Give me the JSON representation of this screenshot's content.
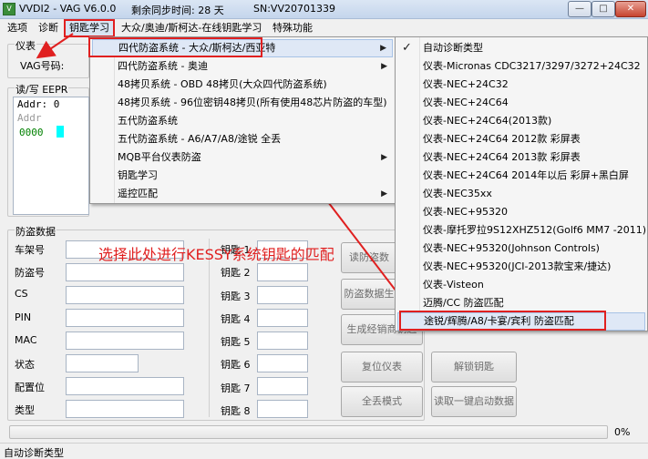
{
  "window": {
    "title": "VVDI2 - VAG V6.0.0",
    "sync_remaining": "剩余同步时间: 28 天",
    "serial": "SN:VV20701339",
    "minimize": "—",
    "maximize": "□",
    "close": "✕"
  },
  "menubar": [
    "选项",
    "诊断",
    "钥匙学习",
    "大众/奥迪/斯柯达-在线钥匙学习",
    "特殊功能"
  ],
  "main": {
    "instrument_group": "仪表",
    "vag_label": "VAG号码:",
    "rw_group": "读/写 EEPR",
    "hex_addr_header": "Addr: 0",
    "hex_col": "Addr",
    "hex_row": "0000"
  },
  "immo": {
    "group_title": "防盗数据",
    "left_labels": [
      "车架号",
      "防盗号",
      "CS",
      "PIN",
      "MAC",
      "状态",
      "配置位",
      "类型"
    ],
    "key_labels": [
      "钥匙 1",
      "钥匙 2",
      "钥匙 3",
      "钥匙 4",
      "钥匙 5",
      "钥匙 6",
      "钥匙 7",
      "钥匙 8"
    ],
    "buttons": [
      "读防盗数",
      "防盗数据生",
      "生成经销商钥匙",
      "复位仪表",
      "解锁钥匙",
      "全丢模式",
      "读取一键启动数据"
    ]
  },
  "menu1": {
    "items": [
      {
        "label": "四代防盗系统 - 大众/斯柯达/西亚特",
        "arrow": "▶"
      },
      {
        "label": "四代防盗系统 - 奥迪",
        "arrow": "▶"
      },
      {
        "label": "48拷贝系统 - OBD 48拷贝(大众四代防盗系统)",
        "arrow": ""
      },
      {
        "label": "48拷贝系统 - 96位密钥48拷贝(所有使用48芯片防盗的车型)",
        "arrow": ""
      },
      {
        "label": "五代防盗系统",
        "arrow": ""
      },
      {
        "label": "五代防盗系统 - A6/A7/A8/途锐 全丢",
        "arrow": ""
      },
      {
        "label": "MQB平台仪表防盗",
        "arrow": "▶"
      },
      {
        "label": "钥匙学习",
        "arrow": ""
      },
      {
        "label": "遥控匹配",
        "arrow": "▶"
      }
    ]
  },
  "menu2": {
    "check": "✓",
    "items": [
      "自动诊断类型",
      "仪表-Micronas CDC3217/3297/3272+24C32",
      "仪表-NEC+24C32",
      "仪表-NEC+24C64",
      "仪表-NEC+24C64(2013款)",
      "仪表-NEC+24C64 2012款 彩屏表",
      "仪表-NEC+24C64 2013款 彩屏表",
      "仪表-NEC+24C64 2014年以后 彩屏+黑白屏",
      "仪表-NEC35xx",
      "仪表-NEC+95320",
      "仪表-摩托罗拉9S12XHZ512(Golf6 MM7 -2011)",
      "仪表-NEC+95320(Johnson Controls)",
      "仪表-NEC+95320(JCI-2013款宝来/捷达)",
      "仪表-Visteon",
      "迈腾/CC 防盗匹配",
      "途锐/辉腾/A8/卡宴/宾利 防盗匹配"
    ]
  },
  "annotation": "选择此处进行KESSY系统钥匙的匹配",
  "progress": {
    "value": 0,
    "label": "0%"
  },
  "status": "自动诊断类型",
  "colors": {
    "annotation": "#e02020",
    "highlight": "#dfe8f6",
    "hex_cyan": "#00ffff",
    "hex_green": "#008000"
  }
}
